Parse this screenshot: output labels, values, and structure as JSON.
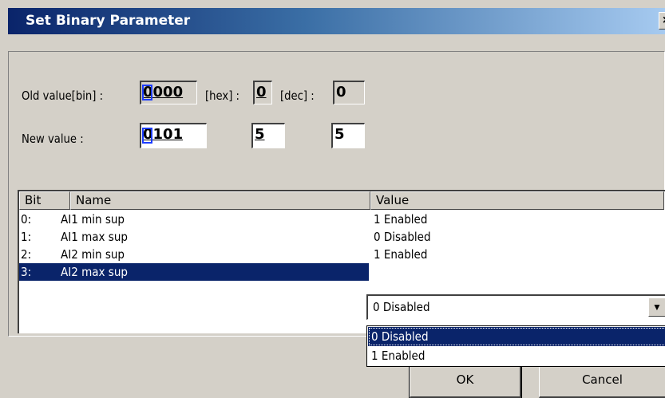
{
  "window": {
    "title": "Set Binary Parameter",
    "close_glyph": "×"
  },
  "old": {
    "label_bin": "Old  value[bin] :",
    "bin": "0000",
    "label_hex": "[hex] :",
    "hex": "0",
    "label_dec": "[dec] :",
    "dec": "0"
  },
  "new": {
    "label": "New value :",
    "bin": "0101",
    "hex": "5",
    "dec": "5"
  },
  "table": {
    "headers": {
      "bit": "Bit",
      "name": "Name",
      "value": "Value"
    },
    "rows": [
      {
        "bit": "0:",
        "name": "AI1 min sup",
        "value": "1 Enabled"
      },
      {
        "bit": "1:",
        "name": "AI1 max sup",
        "value": "0 Disabled"
      },
      {
        "bit": "2:",
        "name": "AI2 min sup",
        "value": "1 Enabled"
      },
      {
        "bit": "3:",
        "name": "AI2 max sup",
        "value": ""
      }
    ]
  },
  "combo": {
    "value": "0 Disabled",
    "arrow": "▼",
    "options": [
      "0 Disabled",
      "1 Enabled"
    ]
  },
  "buttons": {
    "ok": "OK",
    "cancel": "Cancel"
  }
}
